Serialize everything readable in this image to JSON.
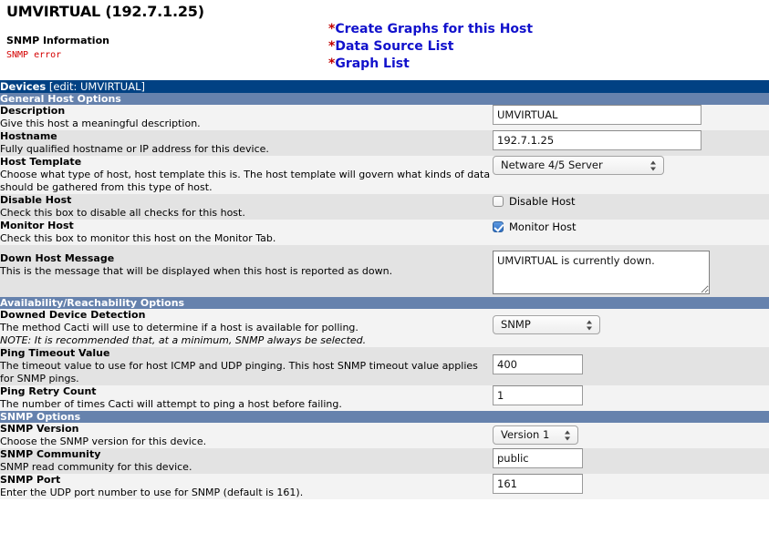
{
  "header": {
    "page_title": "UMVIRTUAL (192.7.1.25)",
    "snmp_info_heading": "SNMP Information",
    "snmp_error": "SNMP error",
    "links": [
      {
        "star": "*",
        "label": "Create Graphs for this Host"
      },
      {
        "star": "*",
        "label": "Data Source List"
      },
      {
        "star": "*",
        "label": "Graph List"
      }
    ],
    "link_color": "#1111cc",
    "star_color": "#c00000",
    "error_color": "#d40000"
  },
  "titlebar": {
    "title": "Devices",
    "subtitle": "[edit: UMVIRTUAL]",
    "bg": "#014183"
  },
  "sections": {
    "general": "General Host Options",
    "availability": "Availability/Reachability Options",
    "snmp": "SNMP Options",
    "bg": "#6682ad"
  },
  "fields": {
    "description": {
      "label": "Description",
      "desc": "Give this host a meaningful description.",
      "value": "UMVIRTUAL"
    },
    "hostname": {
      "label": "Hostname",
      "desc": "Fully qualified hostname or IP address for this device.",
      "value": "192.7.1.25"
    },
    "host_template": {
      "label": "Host Template",
      "desc": "Choose what type of host, host template this is. The host template will govern what kinds of data should be gathered from this type of host.",
      "value": "Netware 4/5 Server"
    },
    "disable_host": {
      "label": "Disable Host",
      "desc": "Check this box to disable all checks for this host.",
      "checkbox_label": "Disable Host",
      "checked": false
    },
    "monitor_host": {
      "label": "Monitor Host",
      "desc": "Check this box to monitor this host on the Monitor Tab.",
      "checkbox_label": "Monitor Host",
      "checked": true
    },
    "down_host_message": {
      "label": "Down Host Message",
      "desc": "This is the message that will be displayed when this host is reported as down.",
      "value": "UMVIRTUAL is currently down."
    },
    "downed_device_detection": {
      "label": "Downed Device Detection",
      "desc": "The method Cacti will use to determine if a host is available for polling.",
      "note": "NOTE: It is recommended that, at a minimum, SNMP always be selected.",
      "value": "SNMP"
    },
    "ping_timeout": {
      "label": "Ping Timeout Value",
      "desc": "The timeout value to use for host ICMP and UDP pinging. This host SNMP timeout value applies for SNMP pings.",
      "value": "400"
    },
    "ping_retry": {
      "label": "Ping Retry Count",
      "desc": "The number of times Cacti will attempt to ping a host before failing.",
      "value": "1"
    },
    "snmp_version": {
      "label": "SNMP Version",
      "desc": "Choose the SNMP version for this device.",
      "value": "Version 1"
    },
    "snmp_community": {
      "label": "SNMP Community",
      "desc": "SNMP read community for this device.",
      "value": "public"
    },
    "snmp_port": {
      "label": "SNMP Port",
      "desc": "Enter the UDP port number to use for SNMP (default is 161).",
      "value": "161"
    }
  }
}
